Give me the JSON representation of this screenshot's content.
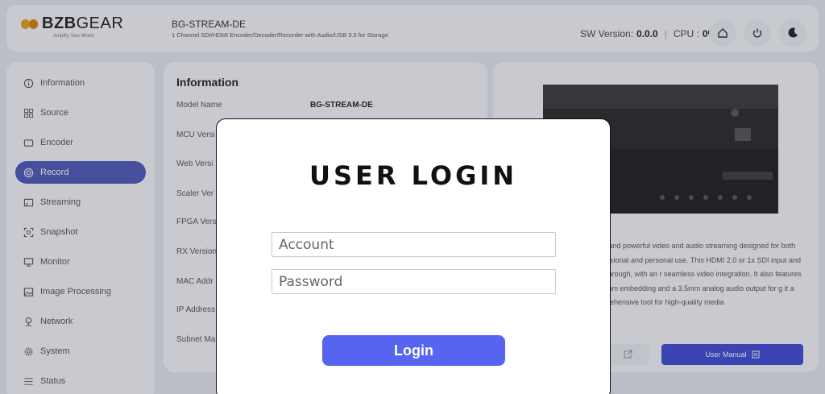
{
  "header": {
    "logo_text_bold": "BZB",
    "logo_text_rest": "GEAR",
    "logo_tagline": "Amplify Your World",
    "device_name": "BG-STREAM-DE",
    "device_subtitle": "1 Channel SDI/HDMI Encoder/Decoder/Recorder with Audio/USB 3.0 for Storage",
    "sw_label": "SW Version:",
    "sw_value": "0.0.0",
    "cpu_label": "CPU :",
    "cpu_value": "0%",
    "icons": [
      "home-icon",
      "power-icon",
      "moon-icon"
    ]
  },
  "sidebar": {
    "items": [
      {
        "label": "Information",
        "icon": "info-icon"
      },
      {
        "label": "Source",
        "icon": "grid-icon"
      },
      {
        "label": "Encoder",
        "icon": "encoder-icon"
      },
      {
        "label": "Record",
        "icon": "record-icon",
        "active": true
      },
      {
        "label": "Streaming",
        "icon": "streaming-icon"
      },
      {
        "label": "Snapshot",
        "icon": "snapshot-icon"
      },
      {
        "label": "Monitor",
        "icon": "monitor-icon"
      },
      {
        "label": "Image Processing",
        "icon": "image-icon"
      },
      {
        "label": "Network",
        "icon": "network-icon"
      },
      {
        "label": "System",
        "icon": "gear-icon"
      },
      {
        "label": "Status",
        "icon": "status-icon"
      }
    ]
  },
  "info": {
    "title": "Information",
    "rows": [
      {
        "label": "Model Name",
        "value": "BG-STREAM-DE"
      },
      {
        "label": "MCU Versi",
        "value": ""
      },
      {
        "label": "Web Versi",
        "value": ""
      },
      {
        "label": "Scaler Ver",
        "value": ""
      },
      {
        "label": "FPGA Vers",
        "value": ""
      },
      {
        "label": "RX Version",
        "value": ""
      },
      {
        "label": "MAC Addr",
        "value": ""
      },
      {
        "label": "IP Address",
        "value": ""
      },
      {
        "label": "Subnet Ma",
        "value": ""
      }
    ]
  },
  "product": {
    "description": "satile and powerful video and audio streaming designed for both professional and personal use. This HDMI 2.0 or 1x SDI input and loop-through, with an r seamless video integration. It also features a 3.5mm embedding and a 3.5mm analog audio output for g it a comprehensive tool for high-quality media",
    "manual_label": "User Manual"
  },
  "modal": {
    "title": "USER LOGIN",
    "account_placeholder": "Account",
    "password_placeholder": "Password",
    "login_label": "Login"
  }
}
